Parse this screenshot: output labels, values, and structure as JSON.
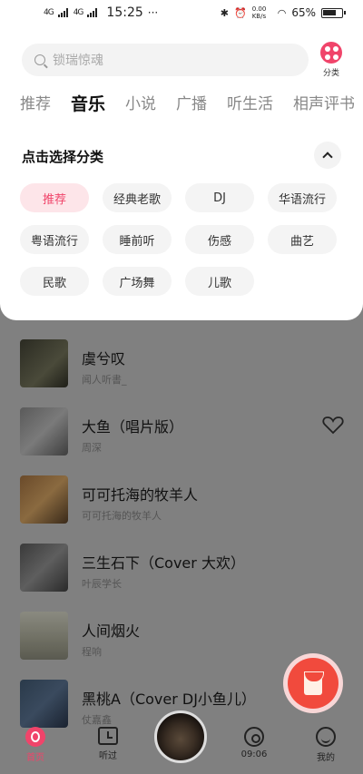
{
  "status_bar": {
    "time": "15:25",
    "signal1": "4G",
    "signal2": "4G",
    "more": "···",
    "speed": "0.00 KB/s",
    "battery": "65%"
  },
  "search": {
    "placeholder": "锁瑞惊魂"
  },
  "category_button": {
    "label": "分类"
  },
  "tabs": [
    "推荐",
    "音乐",
    "小说",
    "广播",
    "听生活",
    "相声评书"
  ],
  "active_tab": "音乐",
  "category_panel": {
    "title": "点击选择分类",
    "chips": [
      "推荐",
      "经典老歌",
      "DJ",
      "华语流行",
      "粤语流行",
      "睡前听",
      "伤感",
      "曲艺",
      "民歌",
      "广场舞",
      "儿歌"
    ],
    "active_chip": "推荐"
  },
  "songs": [
    {
      "title": "虞兮叹",
      "artist": "闻人听書_"
    },
    {
      "title": "大鱼（唱片版）",
      "artist": "周深"
    },
    {
      "title": "可可托海的牧羊人",
      "artist": "可可托海的牧羊人"
    },
    {
      "title": "三生石下（Cover 大欢）",
      "artist": "叶辰学长"
    },
    {
      "title": "人间烟火",
      "artist": "程响"
    },
    {
      "title": "黑桃A（Cover DJ小鱼儿）",
      "artist": "仗嘉鑫"
    }
  ],
  "bottom_nav": [
    {
      "label": "首页",
      "icon": "home-icon"
    },
    {
      "label": "听过",
      "icon": "history-icon"
    },
    {
      "label": "09:06",
      "icon": "disc-icon"
    },
    {
      "label": "我的",
      "icon": "profile-icon"
    }
  ],
  "colors": {
    "accent": "#f0446a",
    "overlay": "#808080",
    "red_envelope": "#f14a3d"
  }
}
